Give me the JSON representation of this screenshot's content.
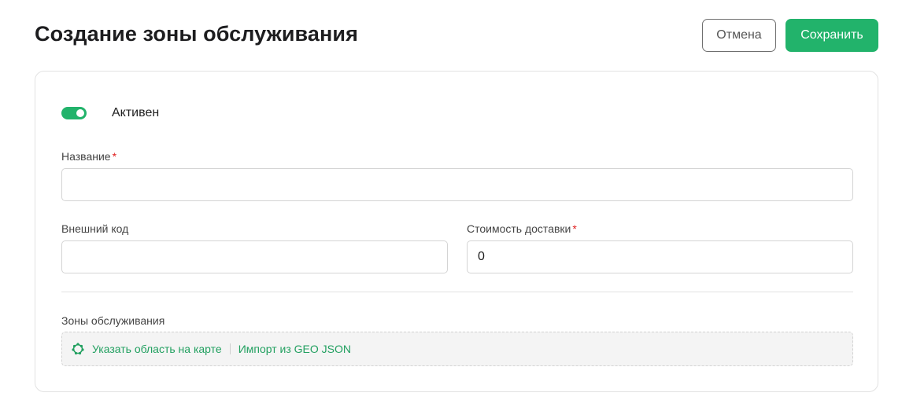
{
  "header": {
    "title": "Создание зоны обслуживания",
    "cancel_label": "Отмена",
    "save_label": "Сохранить"
  },
  "form": {
    "active": {
      "label": "Активен",
      "checked": true
    },
    "name": {
      "label": "Название",
      "required_mark": "*",
      "value": ""
    },
    "external_code": {
      "label": "Внешний код",
      "value": ""
    },
    "delivery_cost": {
      "label": "Стоимость доставки",
      "required_mark": "*",
      "value": "0"
    },
    "zones": {
      "label": "Зоны обслуживания",
      "map_link": "Указать область на карте",
      "import_link": "Импорт из GEO JSON",
      "map_icon": "polygon-icon"
    }
  },
  "colors": {
    "accent": "#22b36b",
    "link": "#22a060",
    "required": "#e02020"
  }
}
